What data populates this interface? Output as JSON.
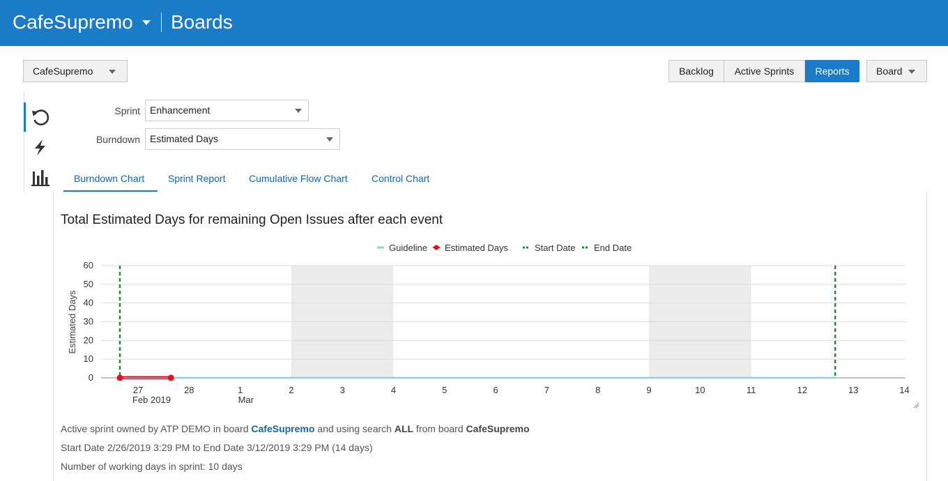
{
  "header": {
    "app_name": "CafeSupremo",
    "section": "Boards"
  },
  "toolbar": {
    "board_select": "CafeSupremo",
    "backlog": "Backlog",
    "active_sprints": "Active Sprints",
    "reports": "Reports",
    "board_menu": "Board"
  },
  "rail": {
    "icons": [
      "refresh-icon",
      "lightning-icon",
      "bar-chart-icon"
    ]
  },
  "form": {
    "sprint_label": "Sprint",
    "sprint_value": "Enhancement",
    "burndown_label": "Burndown",
    "burndown_value": "Estimated Days"
  },
  "tabs": [
    "Burndown Chart",
    "Sprint Report",
    "Cumulative Flow Chart",
    "Control Chart"
  ],
  "active_tab": "Burndown Chart",
  "chart_title": "Total Estimated Days for remaining Open Issues after each event",
  "chart_data": {
    "type": "line",
    "title": "Total Estimated Days for remaining Open Issues after each event",
    "ylabel": "Estimated Days",
    "xlabel": "",
    "ylim": [
      0,
      60
    ],
    "yticks": [
      0,
      10,
      20,
      30,
      40,
      50,
      60
    ],
    "x_tick_labels": [
      "27",
      "28",
      "1",
      "2",
      "3",
      "4",
      "5",
      "6",
      "7",
      "8",
      "9",
      "10",
      "11",
      "12",
      "13",
      "14"
    ],
    "x_tick_sublabels": {
      "27": "Feb 2019",
      "1": "Mar"
    },
    "legend": [
      "Guideline",
      "Estimated Days",
      "Start Date",
      "End Date"
    ],
    "legend_position": "top",
    "grid": true,
    "colors": {
      "guideline": "#8fd0dc",
      "estimated": "#e8101d",
      "start_date": "#1e8a3c",
      "end_date": "#1e8a3c",
      "weekend": "#ececec"
    },
    "series": [
      {
        "name": "Guideline",
        "x": [
          "2019-02-26 15:29",
          "2019-03-12 15:29"
        ],
        "y": [
          0,
          0
        ]
      },
      {
        "name": "Estimated Days",
        "x": [
          "2019-02-26 15:29",
          "2019-02-27 15:29"
        ],
        "y": [
          0,
          0
        ]
      }
    ],
    "start_date": "2019-02-26 15:29",
    "end_date": "2019-03-12 15:29",
    "non_working_periods": [
      [
        "2019-03-02",
        "2019-03-04"
      ],
      [
        "2019-03-09",
        "2019-03-11"
      ]
    ]
  },
  "info": {
    "line1_prefix": "Active sprint owned by ATP DEMO in board ",
    "line1_board": "CafeSupremo",
    "line1_mid": " and using search ",
    "line1_search": "ALL",
    "line1_from": " from board ",
    "line1_board2": "CafeSupremo",
    "line2": "Start Date 2/26/2019 3:29 PM to End Date 3/12/2019 3:29 PM (14 days)",
    "line3": "Number of working days in sprint: 10 days"
  }
}
